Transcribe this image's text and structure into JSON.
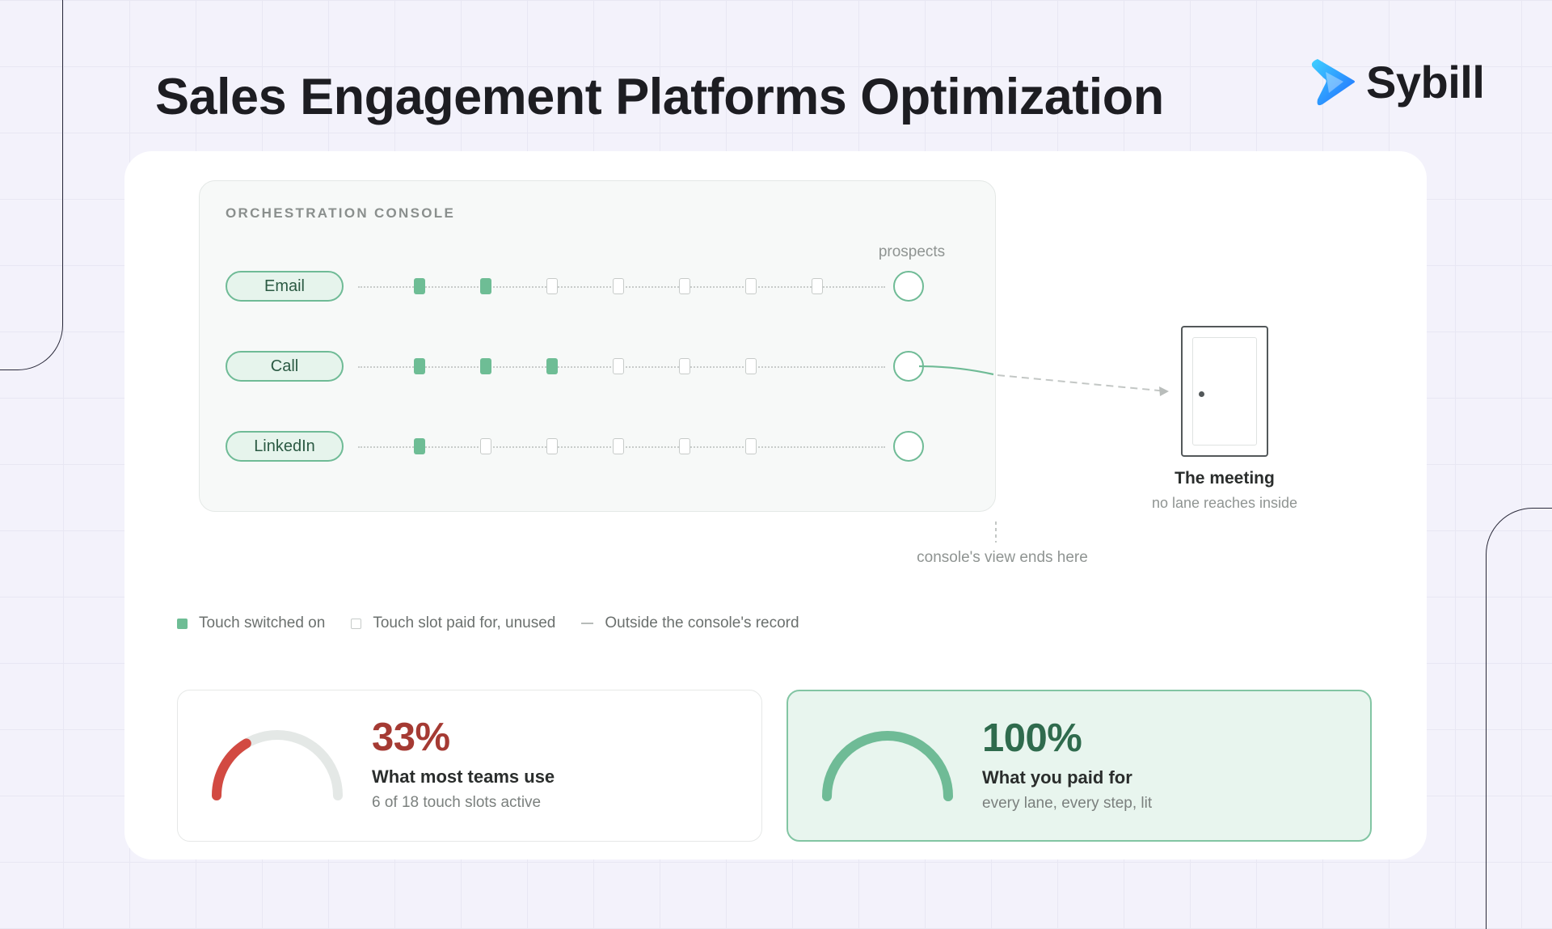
{
  "header": {
    "title": "Sales Engagement Platforms Optimization",
    "brand": "Sybill"
  },
  "console": {
    "title": "ORCHESTRATION CONSOLE",
    "prospects_label": "prospects",
    "lanes": [
      {
        "label": "Email",
        "slots": [
          "on",
          "on",
          "off",
          "off",
          "off",
          "off",
          "off"
        ]
      },
      {
        "label": "Call",
        "slots": [
          "on",
          "on",
          "on",
          "off",
          "off",
          "off"
        ]
      },
      {
        "label": "LinkedIn",
        "slots": [
          "on",
          "off",
          "off",
          "off",
          "off",
          "off"
        ]
      }
    ]
  },
  "meeting": {
    "title": "The meeting",
    "subtitle": "no lane reaches inside",
    "boundary_note": "console's view ends here"
  },
  "legend": {
    "switched_on": "Touch switched on",
    "paid_unused": "Touch slot paid for, unused",
    "outside": "Outside the console's record"
  },
  "stats": [
    {
      "value": "33%",
      "fill": 0.33,
      "label": "What most teams use",
      "sub": "6 of 18 touch slots active",
      "color": "#d24a42"
    },
    {
      "value": "100%",
      "fill": 1.0,
      "label": "What you paid for",
      "sub": "every lane, every step, lit",
      "color": "#6fbb96"
    }
  ],
  "colors": {
    "accent_green": "#6ebd95",
    "accent_red": "#d24a42",
    "brand_blue": "#2f8fff"
  }
}
